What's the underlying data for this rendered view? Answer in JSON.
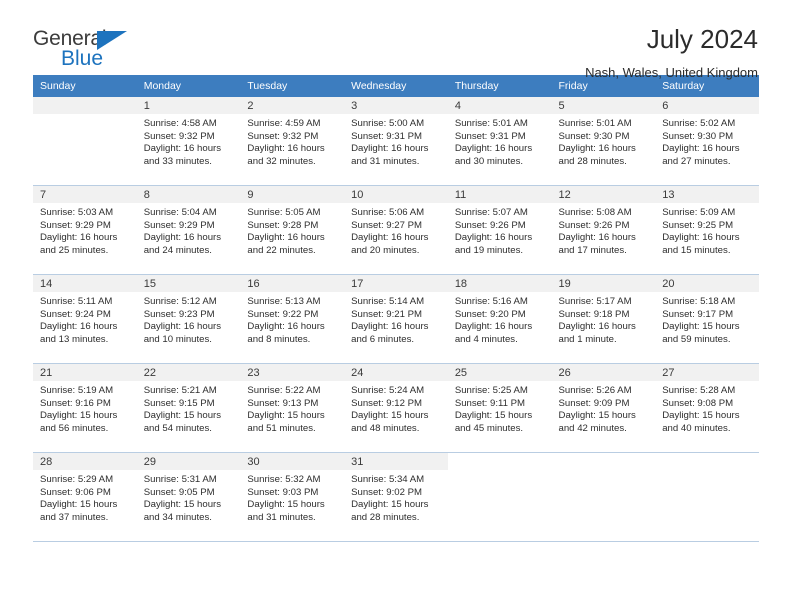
{
  "brand": {
    "name_top": "General",
    "name_bottom": "Blue",
    "triangle_color": "#1d73be"
  },
  "header": {
    "title": "July 2024",
    "subtitle": "Nash, Wales, United Kingdom"
  },
  "theme": {
    "header_row_bg": "#3d7dbf",
    "daynum_bg": "#f1f1f1",
    "grid_line": "#b9cde2"
  },
  "labels": {
    "sunrise_prefix": "Sunrise:",
    "sunset_prefix": "Sunset:",
    "daylight_prefix": "Daylight:"
  },
  "weekdays": [
    "Sunday",
    "Monday",
    "Tuesday",
    "Wednesday",
    "Thursday",
    "Friday",
    "Saturday"
  ],
  "weeks": [
    [
      {
        "day": "",
        "sunrise": "",
        "sunset": "",
        "daylight_1": "",
        "daylight_2": "",
        "blank": true
      },
      {
        "day": "1",
        "sunrise": "Sunrise: 4:58 AM",
        "sunset": "Sunset: 9:32 PM",
        "daylight_1": "Daylight: 16 hours",
        "daylight_2": "and 33 minutes."
      },
      {
        "day": "2",
        "sunrise": "Sunrise: 4:59 AM",
        "sunset": "Sunset: 9:32 PM",
        "daylight_1": "Daylight: 16 hours",
        "daylight_2": "and 32 minutes."
      },
      {
        "day": "3",
        "sunrise": "Sunrise: 5:00 AM",
        "sunset": "Sunset: 9:31 PM",
        "daylight_1": "Daylight: 16 hours",
        "daylight_2": "and 31 minutes."
      },
      {
        "day": "4",
        "sunrise": "Sunrise: 5:01 AM",
        "sunset": "Sunset: 9:31 PM",
        "daylight_1": "Daylight: 16 hours",
        "daylight_2": "and 30 minutes."
      },
      {
        "day": "5",
        "sunrise": "Sunrise: 5:01 AM",
        "sunset": "Sunset: 9:30 PM",
        "daylight_1": "Daylight: 16 hours",
        "daylight_2": "and 28 minutes."
      },
      {
        "day": "6",
        "sunrise": "Sunrise: 5:02 AM",
        "sunset": "Sunset: 9:30 PM",
        "daylight_1": "Daylight: 16 hours",
        "daylight_2": "and 27 minutes."
      }
    ],
    [
      {
        "day": "7",
        "sunrise": "Sunrise: 5:03 AM",
        "sunset": "Sunset: 9:29 PM",
        "daylight_1": "Daylight: 16 hours",
        "daylight_2": "and 25 minutes."
      },
      {
        "day": "8",
        "sunrise": "Sunrise: 5:04 AM",
        "sunset": "Sunset: 9:29 PM",
        "daylight_1": "Daylight: 16 hours",
        "daylight_2": "and 24 minutes."
      },
      {
        "day": "9",
        "sunrise": "Sunrise: 5:05 AM",
        "sunset": "Sunset: 9:28 PM",
        "daylight_1": "Daylight: 16 hours",
        "daylight_2": "and 22 minutes."
      },
      {
        "day": "10",
        "sunrise": "Sunrise: 5:06 AM",
        "sunset": "Sunset: 9:27 PM",
        "daylight_1": "Daylight: 16 hours",
        "daylight_2": "and 20 minutes."
      },
      {
        "day": "11",
        "sunrise": "Sunrise: 5:07 AM",
        "sunset": "Sunset: 9:26 PM",
        "daylight_1": "Daylight: 16 hours",
        "daylight_2": "and 19 minutes."
      },
      {
        "day": "12",
        "sunrise": "Sunrise: 5:08 AM",
        "sunset": "Sunset: 9:26 PM",
        "daylight_1": "Daylight: 16 hours",
        "daylight_2": "and 17 minutes."
      },
      {
        "day": "13",
        "sunrise": "Sunrise: 5:09 AM",
        "sunset": "Sunset: 9:25 PM",
        "daylight_1": "Daylight: 16 hours",
        "daylight_2": "and 15 minutes."
      }
    ],
    [
      {
        "day": "14",
        "sunrise": "Sunrise: 5:11 AM",
        "sunset": "Sunset: 9:24 PM",
        "daylight_1": "Daylight: 16 hours",
        "daylight_2": "and 13 minutes."
      },
      {
        "day": "15",
        "sunrise": "Sunrise: 5:12 AM",
        "sunset": "Sunset: 9:23 PM",
        "daylight_1": "Daylight: 16 hours",
        "daylight_2": "and 10 minutes."
      },
      {
        "day": "16",
        "sunrise": "Sunrise: 5:13 AM",
        "sunset": "Sunset: 9:22 PM",
        "daylight_1": "Daylight: 16 hours",
        "daylight_2": "and 8 minutes."
      },
      {
        "day": "17",
        "sunrise": "Sunrise: 5:14 AM",
        "sunset": "Sunset: 9:21 PM",
        "daylight_1": "Daylight: 16 hours",
        "daylight_2": "and 6 minutes."
      },
      {
        "day": "18",
        "sunrise": "Sunrise: 5:16 AM",
        "sunset": "Sunset: 9:20 PM",
        "daylight_1": "Daylight: 16 hours",
        "daylight_2": "and 4 minutes."
      },
      {
        "day": "19",
        "sunrise": "Sunrise: 5:17 AM",
        "sunset": "Sunset: 9:18 PM",
        "daylight_1": "Daylight: 16 hours",
        "daylight_2": "and 1 minute."
      },
      {
        "day": "20",
        "sunrise": "Sunrise: 5:18 AM",
        "sunset": "Sunset: 9:17 PM",
        "daylight_1": "Daylight: 15 hours",
        "daylight_2": "and 59 minutes."
      }
    ],
    [
      {
        "day": "21",
        "sunrise": "Sunrise: 5:19 AM",
        "sunset": "Sunset: 9:16 PM",
        "daylight_1": "Daylight: 15 hours",
        "daylight_2": "and 56 minutes."
      },
      {
        "day": "22",
        "sunrise": "Sunrise: 5:21 AM",
        "sunset": "Sunset: 9:15 PM",
        "daylight_1": "Daylight: 15 hours",
        "daylight_2": "and 54 minutes."
      },
      {
        "day": "23",
        "sunrise": "Sunrise: 5:22 AM",
        "sunset": "Sunset: 9:13 PM",
        "daylight_1": "Daylight: 15 hours",
        "daylight_2": "and 51 minutes."
      },
      {
        "day": "24",
        "sunrise": "Sunrise: 5:24 AM",
        "sunset": "Sunset: 9:12 PM",
        "daylight_1": "Daylight: 15 hours",
        "daylight_2": "and 48 minutes."
      },
      {
        "day": "25",
        "sunrise": "Sunrise: 5:25 AM",
        "sunset": "Sunset: 9:11 PM",
        "daylight_1": "Daylight: 15 hours",
        "daylight_2": "and 45 minutes."
      },
      {
        "day": "26",
        "sunrise": "Sunrise: 5:26 AM",
        "sunset": "Sunset: 9:09 PM",
        "daylight_1": "Daylight: 15 hours",
        "daylight_2": "and 42 minutes."
      },
      {
        "day": "27",
        "sunrise": "Sunrise: 5:28 AM",
        "sunset": "Sunset: 9:08 PM",
        "daylight_1": "Daylight: 15 hours",
        "daylight_2": "and 40 minutes."
      }
    ],
    [
      {
        "day": "28",
        "sunrise": "Sunrise: 5:29 AM",
        "sunset": "Sunset: 9:06 PM",
        "daylight_1": "Daylight: 15 hours",
        "daylight_2": "and 37 minutes."
      },
      {
        "day": "29",
        "sunrise": "Sunrise: 5:31 AM",
        "sunset": "Sunset: 9:05 PM",
        "daylight_1": "Daylight: 15 hours",
        "daylight_2": "and 34 minutes."
      },
      {
        "day": "30",
        "sunrise": "Sunrise: 5:32 AM",
        "sunset": "Sunset: 9:03 PM",
        "daylight_1": "Daylight: 15 hours",
        "daylight_2": "and 31 minutes."
      },
      {
        "day": "31",
        "sunrise": "Sunrise: 5:34 AM",
        "sunset": "Sunset: 9:02 PM",
        "daylight_1": "Daylight: 15 hours",
        "daylight_2": "and 28 minutes."
      },
      {
        "day": "",
        "sunrise": "",
        "sunset": "",
        "daylight_1": "",
        "daylight_2": "",
        "void": true
      },
      {
        "day": "",
        "sunrise": "",
        "sunset": "",
        "daylight_1": "",
        "daylight_2": "",
        "void": true
      },
      {
        "day": "",
        "sunrise": "",
        "sunset": "",
        "daylight_1": "",
        "daylight_2": "",
        "void": true
      }
    ]
  ]
}
